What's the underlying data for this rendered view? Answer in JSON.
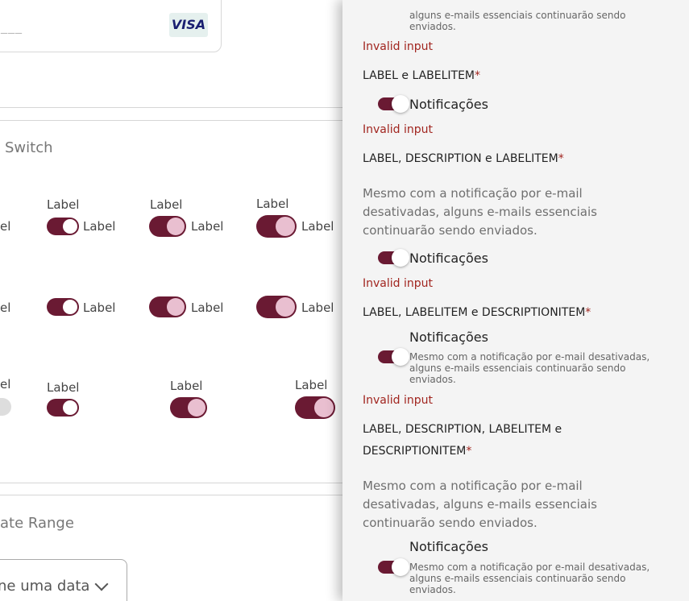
{
  "left": {
    "card_mask": "___",
    "card_brand": "VISA",
    "switch_section_title": "Switch",
    "switch_label": "Label",
    "row1_cut_label": "el",
    "row2_cut_label": "el",
    "row3_cut_label": "el",
    "date_section_title": "ate Range",
    "date_placeholder": "ne uma data"
  },
  "panel": {
    "top_cut_text": "alguns e-mails essenciais continuarão sendo",
    "top_cut_text2": "enviados.",
    "invalid_input": "Invalid input",
    "item_label": "Notificações",
    "description": "Mesmo com a notificação por e-mail desativadas, alguns e-mails essenciais continuarão sendo enviados.",
    "h_label_labelitem": "LABEL e LABELITEM",
    "h_label_description_labelitem": "LABEL, DESCRIPTION e LABELITEM",
    "h_label_labelitem_descriptionitem": "LABEL, LABELITEM e DESCRIPTIONITEM",
    "h_full_line1": "LABEL, DESCRIPTION, LABELITEM e",
    "h_full_line2": "DESCRIPTIONITEM",
    "required_mark": "*"
  },
  "colors": {
    "accent": "#6a1a33",
    "knob_pink": "#e9bfd0",
    "error": "#a1251f"
  }
}
